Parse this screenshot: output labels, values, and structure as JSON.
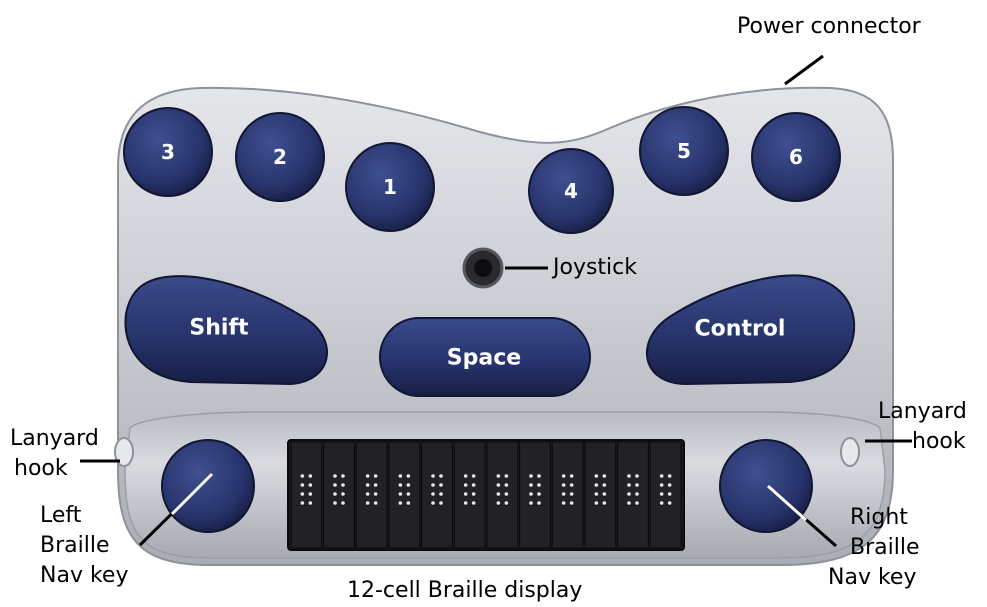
{
  "callouts": {
    "power_connector": "Power connector",
    "joystick": "Joystick",
    "lanyard_hook_left_1": "Lanyard",
    "lanyard_hook_left_2": "hook",
    "lanyard_hook_right_1": "Lanyard",
    "lanyard_hook_right_2": "hook",
    "left_nav_1": "Left",
    "left_nav_2": "Braille",
    "left_nav_3": "Nav key",
    "right_nav_1": "Right",
    "right_nav_2": "Braille",
    "right_nav_3": "Nav key",
    "display": "12-cell Braille display"
  },
  "keys": {
    "dot3": "3",
    "dot2": "2",
    "dot1": "1",
    "dot4": "4",
    "dot5": "5",
    "dot6": "6",
    "shift": "Shift",
    "space": "Space",
    "control": "Control"
  },
  "braille_display": {
    "cell_count": 12
  },
  "colors": {
    "device_body": "#c9ccd2",
    "key_blue": "#26336a",
    "display": "#1c1c1e",
    "pin": "#e8e8e8"
  }
}
